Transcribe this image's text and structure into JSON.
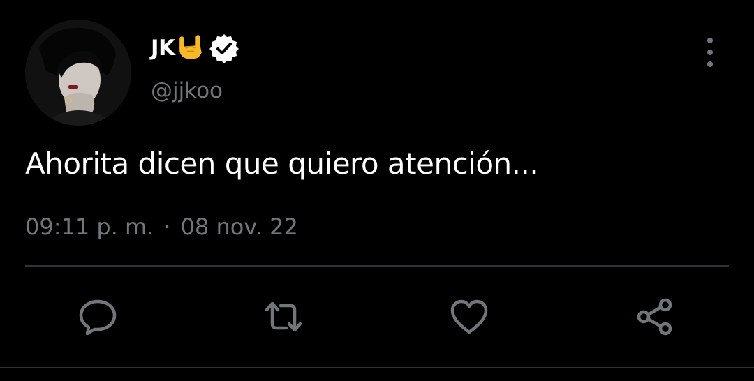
{
  "tweet": {
    "author_name": "JK",
    "author_handle": "@jjkoo",
    "verified": true,
    "name_emoji_icon": "rock-on-hand-icon",
    "text": "Ahorita dicen que quiero atención...",
    "time": "09:11 p. m.",
    "separator": "·",
    "date": "08 nov. 22"
  },
  "actions": [
    {
      "icon": "reply-icon"
    },
    {
      "icon": "retweet-icon"
    },
    {
      "icon": "like-icon"
    },
    {
      "icon": "share-icon"
    }
  ],
  "colors": {
    "background": "#000000",
    "primary_text": "#ffffff",
    "secondary_text": "#71767b",
    "divider": "#2f3336",
    "emoji": "#f7b82a"
  }
}
